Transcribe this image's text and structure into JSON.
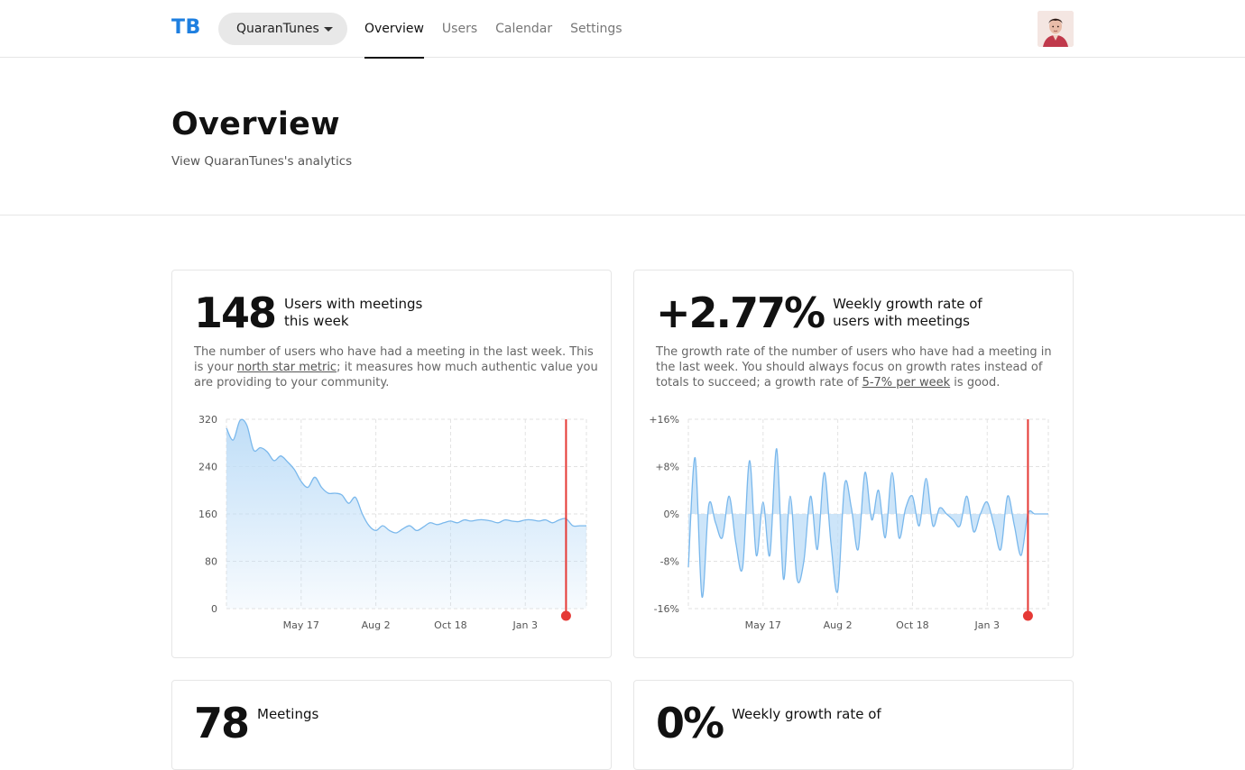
{
  "header": {
    "logo": "TB",
    "org_select": "QuaranTunes",
    "tabs": [
      {
        "label": "Overview",
        "active": true
      },
      {
        "label": "Users",
        "active": false
      },
      {
        "label": "Calendar",
        "active": false
      },
      {
        "label": "Settings",
        "active": false
      }
    ],
    "avatar_icon": "user-avatar"
  },
  "page": {
    "title": "Overview",
    "subtitle": "View QuaranTunes's analytics"
  },
  "cards": [
    {
      "value": "148",
      "label": "Users with meetings this week",
      "desc_pre": "The number of users who have had a meeting in the last week. This is your ",
      "desc_link": "north star metric",
      "desc_post": "; it measures how much authentic value you are providing to your community."
    },
    {
      "value": "+2.77%",
      "label": "Weekly growth rate of users with meetings",
      "desc_pre": "The growth rate of the number of users who have had a meeting in the last week. You should always focus on growth rates instead of totals to succeed; a growth rate of ",
      "desc_link": "5-7% per week",
      "desc_post": " is good."
    },
    {
      "value": "78",
      "label": "Meetings"
    },
    {
      "value": "0%",
      "label": "Weekly growth rate of"
    }
  ],
  "colors": {
    "accent": "#1e7fe0",
    "series_line": "#7ab8ec",
    "series_fill": "#bcdcf7",
    "marker": "#e53935"
  },
  "chart_data": [
    {
      "type": "area",
      "ylim": [
        0,
        320
      ],
      "yticks": [
        "320",
        "240",
        "160",
        "80",
        "0"
      ],
      "xticks": [
        "May 17",
        "Aug 2",
        "Oct 18",
        "Jan 3"
      ],
      "xtick_weeks": [
        11,
        22,
        33,
        44
      ],
      "marker_week": 50,
      "grid": true,
      "values": [
        305,
        285,
        318,
        310,
        268,
        272,
        265,
        250,
        258,
        248,
        235,
        215,
        205,
        222,
        205,
        195,
        195,
        192,
        178,
        188,
        160,
        140,
        132,
        140,
        132,
        128,
        135,
        140,
        132,
        138,
        145,
        142,
        145,
        148,
        145,
        150,
        148,
        150,
        150,
        148,
        145,
        150,
        148,
        147,
        150,
        150,
        148,
        150,
        145,
        150,
        152,
        140,
        140,
        140
      ]
    },
    {
      "type": "line",
      "ylim": [
        -16,
        16
      ],
      "yticks": [
        "+16%",
        "+8%",
        "0%",
        "-8%",
        "-16%"
      ],
      "xticks": [
        "May 17",
        "Aug 2",
        "Oct 18",
        "Jan 3"
      ],
      "xtick_weeks": [
        11,
        22,
        33,
        44
      ],
      "marker_week": 50,
      "grid": true,
      "values": [
        -9,
        9.5,
        -14,
        1.5,
        -1.5,
        -4,
        3,
        -5,
        -9,
        9,
        -7,
        2,
        -7,
        11,
        -11,
        3,
        -11,
        -8,
        3,
        -6,
        7,
        -5,
        -13,
        5,
        1,
        -6,
        7,
        -1,
        4,
        -4,
        7,
        -4,
        1,
        3,
        -2,
        6,
        -2,
        1,
        0,
        -1,
        -2,
        3,
        -3,
        0,
        2,
        -2,
        -6,
        3,
        -2,
        -7,
        0,
        0,
        0,
        0
      ]
    }
  ]
}
